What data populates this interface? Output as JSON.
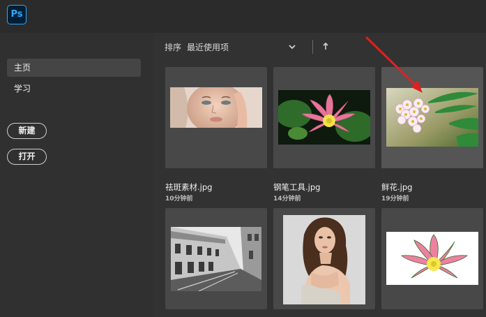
{
  "app": {
    "logo_text": "Ps",
    "brand_color": "#31a8ff"
  },
  "sidebar": {
    "items": [
      {
        "label": "主页",
        "active": true
      },
      {
        "label": "学习",
        "active": false
      }
    ],
    "new_button": "新建",
    "open_button": "打开"
  },
  "sort": {
    "label": "排序",
    "value": "最近使用项",
    "dropdown_icon": "chevron-down-icon",
    "order_icon": "arrow-up-icon"
  },
  "files": [
    {
      "name": "祛斑素材.jpg",
      "time": "10分钟前"
    },
    {
      "name": "钢笔工具.jpg",
      "time": "14分钟前"
    },
    {
      "name": "鲜花.jpg",
      "time": "19分钟前"
    },
    {
      "name": "",
      "time": ""
    },
    {
      "name": "",
      "time": ""
    },
    {
      "name": "",
      "time": ""
    }
  ],
  "annotation": {
    "color": "#e02020"
  }
}
